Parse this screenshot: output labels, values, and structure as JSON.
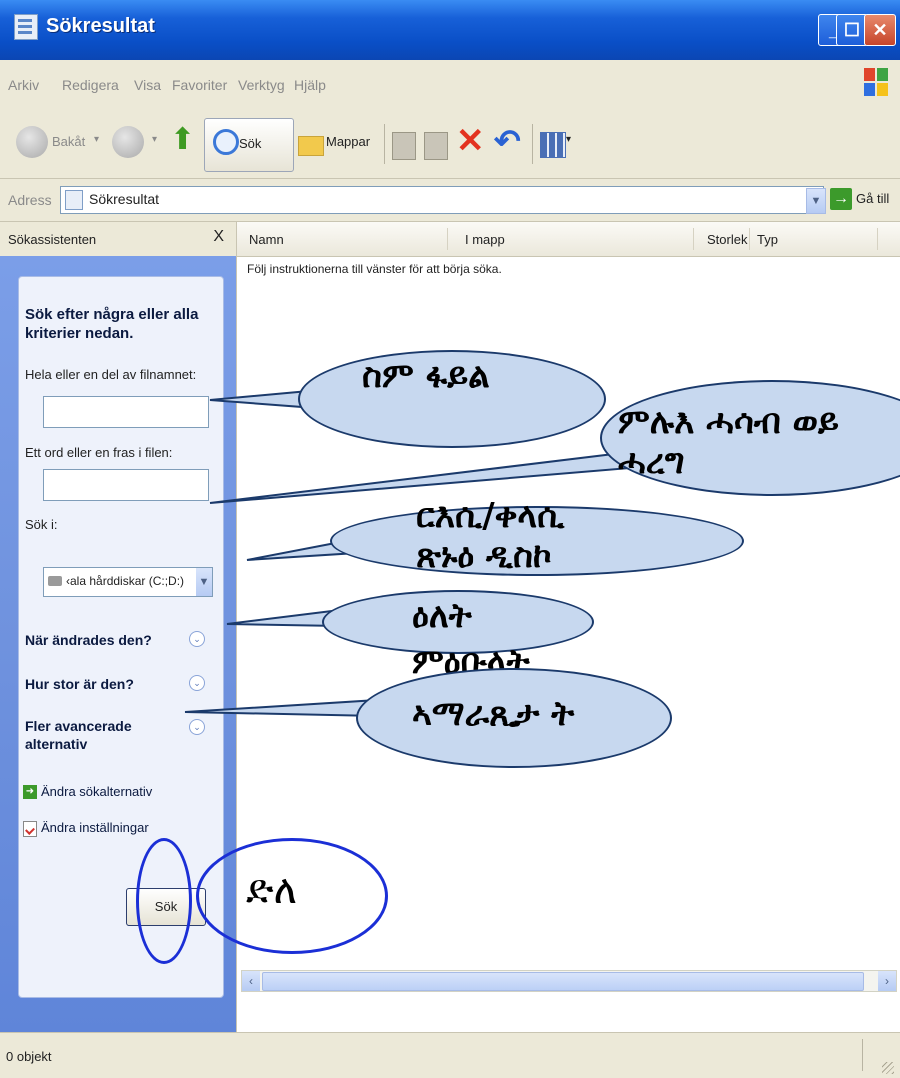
{
  "window": {
    "title": "Sökresultat"
  },
  "menu": [
    "Arkiv",
    "Redigera",
    "Visa",
    "Favoriter",
    "Verktyg",
    "Hjälp"
  ],
  "toolbar": {
    "back_label": "Bakåt",
    "search_label": "Sök",
    "folders_label": "Mappar"
  },
  "address": {
    "label": "Adress",
    "value": "Sökresultat",
    "go_label": "Gå till"
  },
  "search_pane": {
    "title": "Sökassistenten",
    "close_glyph": "X",
    "heading": "Sök efter några eller alla kriterier nedan.",
    "filename_label": "Hela eller en del av filnamnet:",
    "filename_value": "",
    "phrase_label": "Ett ord eller en fras i filen:",
    "phrase_value": "",
    "lookin_label": "Sök i:",
    "lookin_value": "‹ala hårddiskar (C:;D:)",
    "option_modified": "När ändrades den?",
    "option_size": "Hur stor är den?",
    "option_advanced": "Fler avancerade alternativ",
    "link_change_options": "Ändra sökalternativ",
    "link_change_settings": "Ändra inställningar",
    "search_button": "Sök"
  },
  "results": {
    "columns": [
      "Namn",
      "I mapp",
      "Storlek",
      "Typ"
    ],
    "instruction": "Följ instruktionerna till vänster för att börja söka."
  },
  "status": {
    "text": "0 objekt"
  },
  "annotations": {
    "filename": "ስም ፋይል",
    "phrase": "ምሉእ ሓሳብ ወይ ሓረግ",
    "lookin": "ርእሲ/ቀላሲ ጽኑዕ ዲስኮ",
    "date": "ዕለት",
    "size": "ምዕቡላት",
    "advanced": "ኣማራጺታ ት",
    "search": "ድለ"
  },
  "colors": {
    "title_bar": "#0a4fc7",
    "chrome": "#ece9d8",
    "pane_bg": "#6f92de",
    "callout_fill": "#c7d8ef",
    "ring_blue": "#1b2fd6"
  }
}
